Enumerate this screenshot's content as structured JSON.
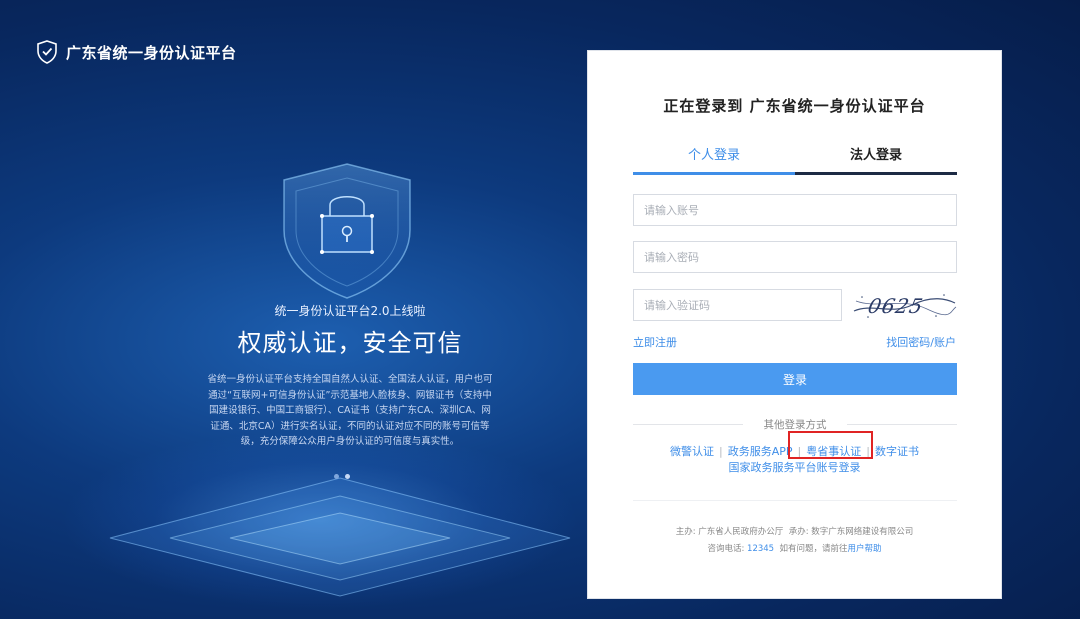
{
  "brand": {
    "name": "广东省统一身份认证平台",
    "icon": "shield-check-icon"
  },
  "hero": {
    "subtitle": "统一身份认证平台2.0上线啦",
    "title": "权威认证，安全可信",
    "description": "省统一身份认证平台支持全国自然人认证、全国法人认证，用户也可通过“互联网+可信身份认证”示范基地人脸核身、网银证书（支持中国建设银行、中国工商银行）、CA证书（支持广东CA、深圳CA、网证通、北京CA）进行实名认证，不同的认证对应不同的账号可信等级，充分保障公众用户身份认证的可信度与真实性。",
    "icon": "lock-shield-icon"
  },
  "card": {
    "title": "正在登录到 广东省统一身份认证平台",
    "tabs": [
      {
        "label": "个人登录",
        "active": true
      },
      {
        "label": "法人登录",
        "active": false
      }
    ],
    "account_placeholder": "请输入账号",
    "password_placeholder": "请输入密码",
    "captcha_placeholder": "请输入验证码",
    "captcha_text": "0625",
    "register_link": "立即注册",
    "forgot_link": "找回密码/账户",
    "login_button": "登录",
    "other_methods_label": "其他登录方式",
    "methods": [
      "微警认证",
      "政务服务APP",
      "粤省事认证",
      "数字证书"
    ],
    "national_link": "国家政务服务平台账号登录",
    "footer": {
      "organizer": "主办: 广东省人民政府办公厅",
      "contractor": "承办: 数字广东网络建设有限公司",
      "hotline_label": "咨询电话:",
      "hotline_number": "12345",
      "help_prefix": "如有问题，请前往",
      "help_link": "用户帮助"
    }
  },
  "colors": {
    "accent": "#4a9af0",
    "highlight": "#e02424",
    "background": "#0d3a7e"
  }
}
